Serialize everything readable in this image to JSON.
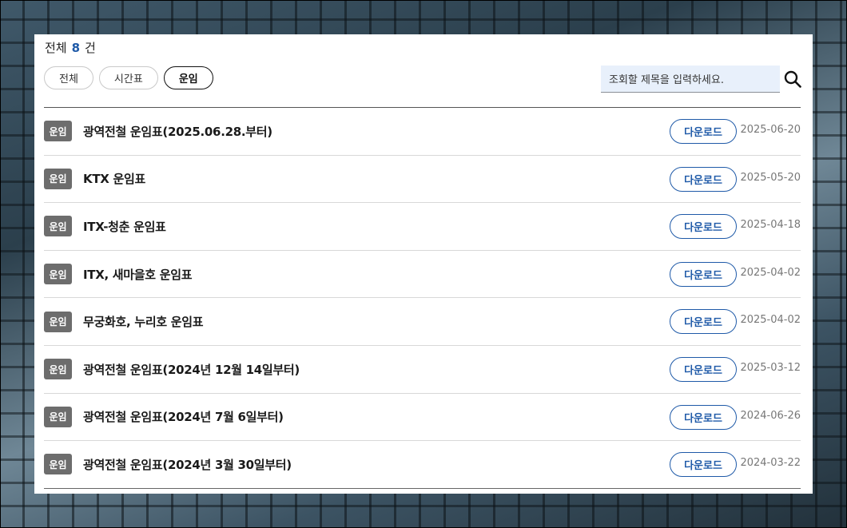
{
  "summary": {
    "label": "전체",
    "count": "8",
    "unit": "건"
  },
  "filters": [
    {
      "label": "전체"
    },
    {
      "label": "시간표"
    },
    {
      "label": "운임",
      "active": true
    }
  ],
  "search": {
    "placeholder": "조회할 제목을 입력하세요."
  },
  "items": [
    {
      "badge": "운임",
      "title": "광역전철 운임표(2025.06.28.부터)",
      "download": "다운로드",
      "date": "2025-06-20"
    },
    {
      "badge": "운임",
      "title": "KTX 운임표",
      "download": "다운로드",
      "date": "2025-05-20"
    },
    {
      "badge": "운임",
      "title": "ITX-청춘 운임표",
      "download": "다운로드",
      "date": "2025-04-18"
    },
    {
      "badge": "운임",
      "title": "ITX, 새마을호 운임표",
      "download": "다운로드",
      "date": "2025-04-02"
    },
    {
      "badge": "운임",
      "title": "무궁화호, 누리호 운임표",
      "download": "다운로드",
      "date": "2025-04-02"
    },
    {
      "badge": "운임",
      "title": "광역전철 운임표(2024년 12월 14일부터)",
      "download": "다운로드",
      "date": "2025-03-12"
    },
    {
      "badge": "운임",
      "title": "광역전철 운임표(2024년 7월 6일부터)",
      "download": "다운로드",
      "date": "2024-06-26"
    },
    {
      "badge": "운임",
      "title": "광역전철 운임표(2024년 3월 30일부터)",
      "download": "다운로드",
      "date": "2024-03-22"
    }
  ],
  "colors": {
    "accent": "#1f5aa8",
    "badge": "#6d6d6d",
    "search_bg": "#e8f0fb"
  }
}
